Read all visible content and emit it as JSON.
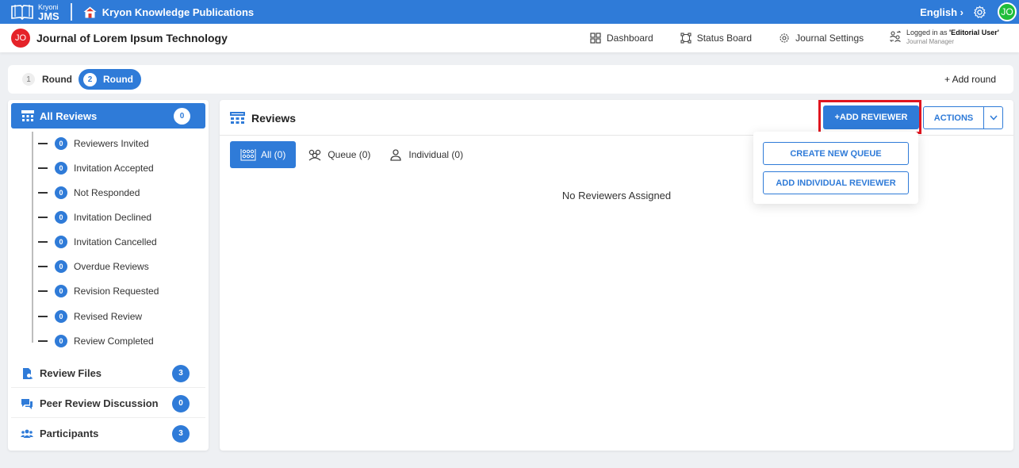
{
  "topbar": {
    "logo_small": "Kryoni",
    "logo_big": "JMS",
    "publisher": "Kryon Knowledge Publications",
    "language": "English ›",
    "user_initials": "JO"
  },
  "journal": {
    "initials": "JO",
    "title": "Journal of Lorem Ipsum Technology",
    "nav": [
      {
        "label": "Dashboard"
      },
      {
        "label": "Status Board"
      },
      {
        "label": "Journal Settings"
      }
    ],
    "logged_in_prefix": "Logged in as ",
    "logged_in_role": "'Editorial User'",
    "role_subtitle": "Journal Manager"
  },
  "rounds": {
    "items": [
      {
        "num": "1",
        "label": "Round"
      },
      {
        "num": "2",
        "label": "Round"
      }
    ],
    "add_label": "+ Add round"
  },
  "sidebar": {
    "all_reviews": {
      "label": "All Reviews",
      "count": "0"
    },
    "sub_items": [
      {
        "label": "Reviewers Invited",
        "count": "0"
      },
      {
        "label": "Invitation Accepted",
        "count": "0"
      },
      {
        "label": "Not Responded",
        "count": "0"
      },
      {
        "label": "Invitation Declined",
        "count": "0"
      },
      {
        "label": "Invitation Cancelled",
        "count": "0"
      },
      {
        "label": "Overdue Reviews",
        "count": "0"
      },
      {
        "label": "Revision Requested",
        "count": "0"
      },
      {
        "label": "Revised Review",
        "count": "0"
      },
      {
        "label": "Review Completed",
        "count": "0"
      }
    ],
    "items": [
      {
        "label": "Review Files",
        "count": "3"
      },
      {
        "label": "Peer Review Discussion",
        "count": "0"
      },
      {
        "label": "Participants",
        "count": "3"
      }
    ]
  },
  "main": {
    "title": "Reviews",
    "add_reviewer": "+ADD REVIEWER",
    "actions": "ACTIONS",
    "filters": [
      {
        "label": "All (0)"
      },
      {
        "label": "Queue (0)"
      },
      {
        "label": "Individual (0)"
      }
    ],
    "empty_message": "No Reviewers Assigned"
  },
  "dropdown": {
    "items": [
      "CREATE NEW QUEUE",
      "ADD INDIVIDUAL REVIEWER"
    ]
  },
  "colors": {
    "primary": "#2f7bd8",
    "highlight": "#e0151f",
    "avatar_green": "#1fbd3a",
    "avatar_red": "#e52329"
  }
}
